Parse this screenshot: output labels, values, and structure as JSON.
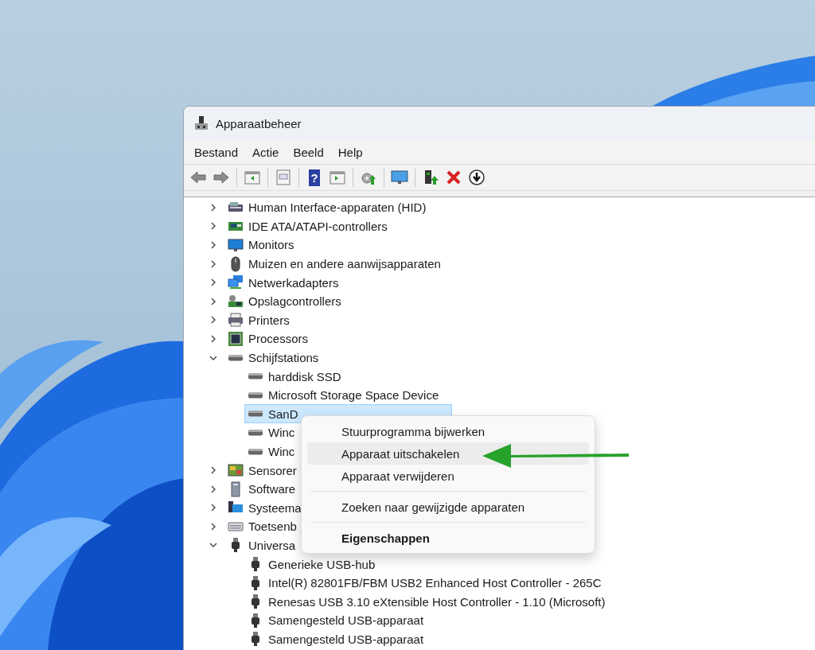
{
  "window": {
    "title": "Apparaatbeheer"
  },
  "menu_bar": [
    {
      "label": "Bestand"
    },
    {
      "label": "Actie"
    },
    {
      "label": "Beeld"
    },
    {
      "label": "Help"
    }
  ],
  "toolbar": [
    {
      "kind": "back"
    },
    {
      "kind": "forward"
    },
    {
      "kind": "separator"
    },
    {
      "kind": "panel-left"
    },
    {
      "kind": "separator"
    },
    {
      "kind": "properties"
    },
    {
      "kind": "separator"
    },
    {
      "kind": "help",
      "glyph": "?"
    },
    {
      "kind": "panel-right"
    },
    {
      "kind": "separator"
    },
    {
      "kind": "update"
    },
    {
      "kind": "separator"
    },
    {
      "kind": "scan"
    },
    {
      "kind": "separator"
    },
    {
      "kind": "enable"
    },
    {
      "kind": "remove"
    },
    {
      "kind": "download"
    }
  ],
  "tree": [
    {
      "label": "Human Interface-apparaten (HID)",
      "kind": "hid",
      "expanded": false,
      "selected": false
    },
    {
      "label": "IDE ATA/ATAPI-controllers",
      "kind": "ide",
      "expanded": false,
      "selected": false
    },
    {
      "label": "Monitors",
      "kind": "monitor",
      "expanded": false,
      "selected": false
    },
    {
      "label": "Muizen en andere aanwijsapparaten",
      "kind": "mouse",
      "expanded": false,
      "selected": false
    },
    {
      "label": "Netwerkadapters",
      "kind": "network",
      "expanded": false,
      "selected": false
    },
    {
      "label": "Opslagcontrollers",
      "kind": "storage",
      "expanded": false,
      "selected": false
    },
    {
      "label": "Printers",
      "kind": "printer",
      "expanded": false,
      "selected": false
    },
    {
      "label": "Processors",
      "kind": "cpu",
      "expanded": false,
      "selected": false
    },
    {
      "label": "Schijfstations",
      "kind": "disk",
      "expanded": true,
      "selected": false,
      "children": [
        {
          "label": "harddisk SSD",
          "kind": "disk",
          "selected": false
        },
        {
          "label": "Microsoft Storage Space Device",
          "kind": "disk",
          "selected": false
        },
        {
          "label": "SanD",
          "kind": "disk",
          "selected": true
        },
        {
          "label": "Winc",
          "kind": "disk",
          "selected": false
        },
        {
          "label": "Winc",
          "kind": "disk",
          "selected": false
        }
      ]
    },
    {
      "label": "Sensorer",
      "kind": "sensor",
      "expanded": false,
      "selected": false
    },
    {
      "label": "Software",
      "kind": "software",
      "expanded": false,
      "selected": false
    },
    {
      "label": "Systeema",
      "kind": "system",
      "expanded": false,
      "selected": false
    },
    {
      "label": "Toetsenb",
      "kind": "keyboard",
      "expanded": false,
      "selected": false
    },
    {
      "label": "Universa",
      "kind": "usb",
      "expanded": true,
      "selected": false,
      "children": [
        {
          "label": "Generieke USB-hub",
          "kind": "usb",
          "selected": false
        },
        {
          "label": "Intel(R) 82801FB/FBM USB2 Enhanced Host Controller - 265C",
          "kind": "usb",
          "selected": false
        },
        {
          "label": "Renesas USB 3.10 eXtensible Host Controller - 1.10 (Microsoft)",
          "kind": "usb",
          "selected": false
        },
        {
          "label": "Samengesteld USB-apparaat",
          "kind": "usb",
          "selected": false
        },
        {
          "label": "Samengesteld USB-apparaat",
          "kind": "usb",
          "selected": false
        }
      ]
    }
  ],
  "context_menu": [
    {
      "kind": "item",
      "label": "Stuurprogramma bijwerken",
      "selected": false
    },
    {
      "kind": "item",
      "label": "Apparaat uitschakelen",
      "selected": true
    },
    {
      "kind": "item",
      "label": "Apparaat verwijderen",
      "selected": false
    },
    {
      "kind": "separator"
    },
    {
      "kind": "item",
      "label": "Zoeken naar gewijzigde apparaten",
      "selected": false
    },
    {
      "kind": "separator"
    },
    {
      "kind": "default",
      "label": "Eigenschappen",
      "selected": false
    }
  ]
}
